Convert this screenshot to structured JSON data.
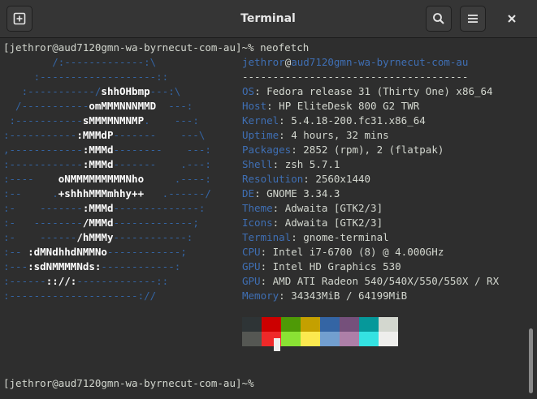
{
  "window": {
    "title": "Terminal"
  },
  "prompt": "[jethror@aud7120gmn-wa-byrnecut-com-au]~% neofetch",
  "prompt_final": "[jethror@aud7120gmn-wa-byrnecut-com-au]~%",
  "header": {
    "user": "jethror",
    "at": "@",
    "host": "aud7120gmn-wa-byrnecut-com-au"
  },
  "separator": "-------------------------------------",
  "art": [
    [
      "        /:-------------:\\",
      "",
      ""
    ],
    [
      "     :-------------------::",
      "",
      ""
    ],
    [
      "   :-----------/",
      "shhOHbmp",
      "---:\\"
    ],
    [
      "  /-----------",
      "omMMMNNNMMD",
      "  ---:"
    ],
    [
      " :-----------",
      "sMMMMNMNMP",
      ".    ---:"
    ],
    [
      ":-----------",
      ":MMMdP",
      "-------    ---\\"
    ],
    [
      ",------------",
      ":MMMd",
      "--------    ---:"
    ],
    [
      ":------------",
      ":MMMd",
      "-------    .---:"
    ],
    [
      ":----    ",
      "oNMMMMMMMMMNho",
      "     .----:"
    ],
    [
      ":--     .",
      "+shhhMMMmhhy++",
      "   .------/"
    ],
    [
      ":-    -------",
      ":MMMd",
      "--------------:"
    ],
    [
      ":-   --------",
      "/MMMd",
      "-------------;"
    ],
    [
      ":-    ------",
      "/hMMMy",
      "------------:"
    ],
    [
      ":-- ",
      ":dMNdhhdNMMNo",
      "------------;"
    ],
    [
      ":---",
      ":sdNMMMMNds:",
      "------------:"
    ],
    [
      ":------",
      ":://:",
      "-------------::",
      ""
    ],
    [
      ":---------------------://",
      "",
      ""
    ]
  ],
  "info": [
    {
      "key": "OS",
      "value": "Fedora release 31 (Thirty One) x86_64"
    },
    {
      "key": "Host",
      "value": "HP EliteDesk 800 G2 TWR"
    },
    {
      "key": "Kernel",
      "value": "5.4.18-200.fc31.x86_64"
    },
    {
      "key": "Uptime",
      "value": "4 hours, 32 mins"
    },
    {
      "key": "Packages",
      "value": "2852 (rpm), 2 (flatpak)"
    },
    {
      "key": "Shell",
      "value": "zsh 5.7.1"
    },
    {
      "key": "Resolution",
      "value": "2560x1440"
    },
    {
      "key": "DE",
      "value": "GNOME 3.34.3"
    },
    {
      "key": "Theme",
      "value": "Adwaita [GTK2/3]"
    },
    {
      "key": "Icons",
      "value": "Adwaita [GTK2/3]"
    },
    {
      "key": "Terminal",
      "value": "gnome-terminal"
    },
    {
      "key": "CPU",
      "value": "Intel i7-6700 (8) @ 4.000GHz"
    },
    {
      "key": "GPU",
      "value": "Intel HD Graphics 530"
    },
    {
      "key": "GPU",
      "value": "AMD ATI Radeon 540/540X/550/550X / RX"
    },
    {
      "key": "Memory",
      "value": "34343MiB / 64199MiB"
    }
  ],
  "palette": {
    "normal": [
      "#2e3436",
      "#cc0000",
      "#4e9a06",
      "#c4a000",
      "#3465a4",
      "#75507b",
      "#06989a",
      "#d3d7cf"
    ],
    "bright": [
      "#555753",
      "#ef2929",
      "#8ae234",
      "#fce94f",
      "#729fcf",
      "#ad7fa8",
      "#34e2e2",
      "#eeeeec"
    ]
  },
  "icons": {
    "new_tab": "new-tab-icon",
    "search": "search-icon",
    "menu": "hamburger-menu-icon",
    "close": "close-icon"
  }
}
